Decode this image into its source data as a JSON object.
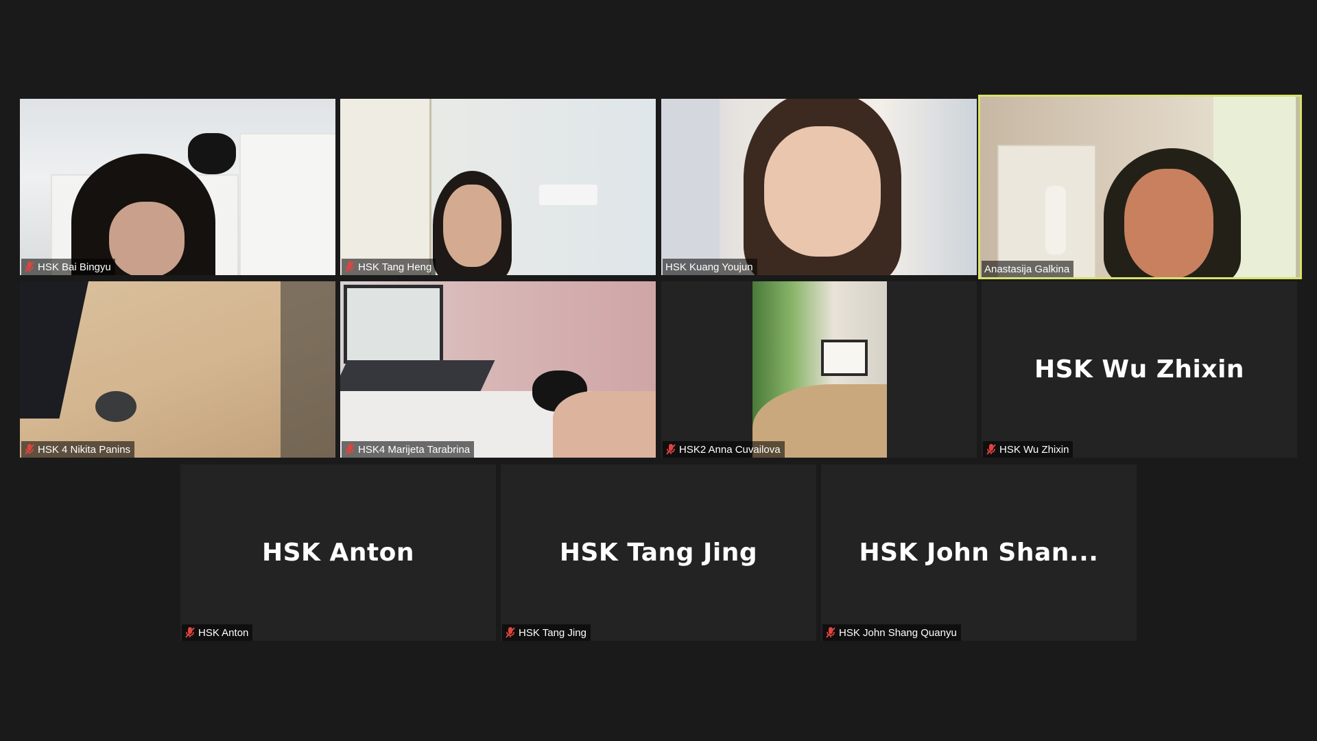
{
  "app": {
    "view": "gallery",
    "active_speaker": "Anastasija Galkina",
    "colors": {
      "background": "#1a1a1a",
      "tile": "#232323",
      "active_border": "#d8e26a",
      "muted_icon": "#e0443e"
    }
  },
  "participants": [
    {
      "name": "HSK Bai Bingyu",
      "muted": true,
      "video": true,
      "icon": "mic-muted-icon"
    },
    {
      "name": "HSK Tang Heng",
      "muted": true,
      "video": true,
      "icon": "mic-muted-icon"
    },
    {
      "name": "HSK Kuang Youjun",
      "muted": false,
      "video": true
    },
    {
      "name": "Anastasija Galkina",
      "muted": false,
      "video": true,
      "active": true
    },
    {
      "name": "HSK 4 Nikita Panins",
      "muted": true,
      "video": true,
      "icon": "mic-muted-icon"
    },
    {
      "name": "HSK4 Marijeta Tarabrina",
      "muted": true,
      "video": true,
      "icon": "mic-muted-icon"
    },
    {
      "name": "HSK2 Anna Cuvailova",
      "muted": true,
      "video": true,
      "icon": "mic-muted-icon"
    },
    {
      "name": "HSK Wu Zhixin",
      "display": "HSK Wu Zhixin",
      "muted": true,
      "video": false,
      "icon": "mic-muted-icon"
    },
    {
      "name": "HSK Anton",
      "display": "HSK Anton",
      "muted": true,
      "video": false,
      "icon": "mic-muted-icon"
    },
    {
      "name": "HSK Tang Jing",
      "display": "HSK Tang Jing",
      "muted": true,
      "video": false,
      "icon": "mic-muted-icon"
    },
    {
      "name": "HSK John Shang Quanyu",
      "display": "HSK  John  Shan...",
      "muted": true,
      "video": false,
      "icon": "mic-muted-icon"
    }
  ]
}
